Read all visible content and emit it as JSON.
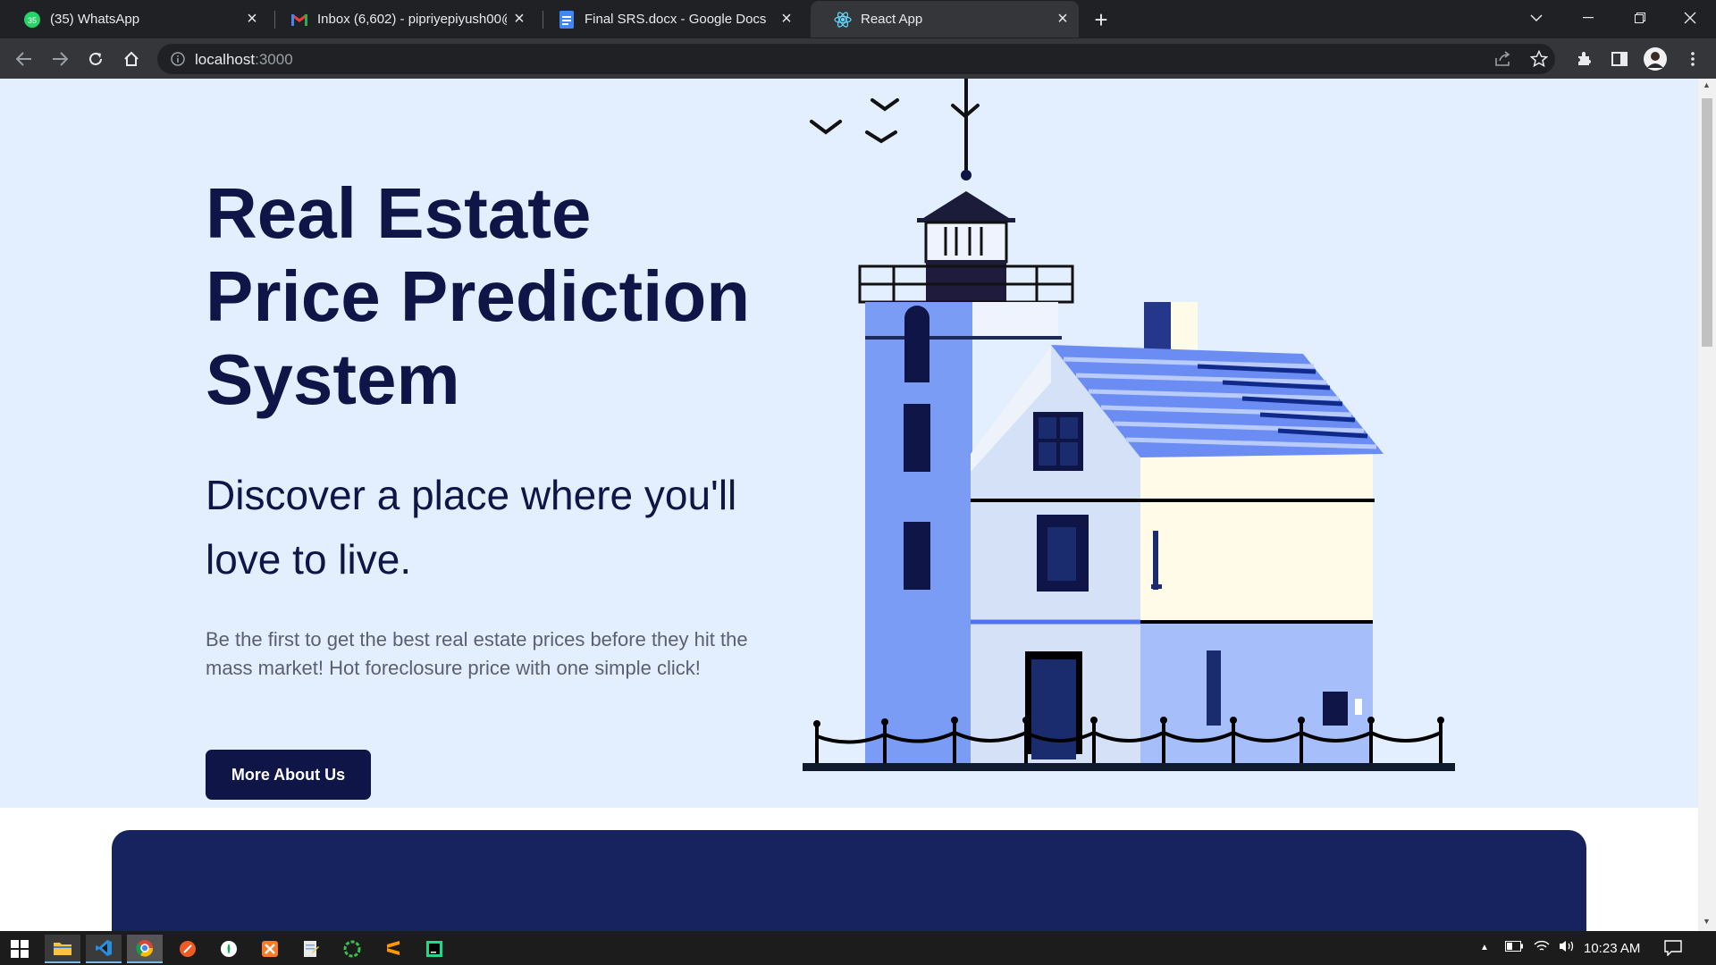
{
  "browser": {
    "tabs": [
      {
        "title": "(35) WhatsApp",
        "icon": "whatsapp-icon",
        "badge": "35"
      },
      {
        "title": "Inbox (6,602) - pipriyepiyush00@",
        "icon": "gmail-icon"
      },
      {
        "title": "Final SRS.docx - Google Docs",
        "icon": "google-docs-icon"
      },
      {
        "title": "React App",
        "icon": "react-icon",
        "active": true
      }
    ],
    "url_host": "localhost",
    "url_port": ":3000"
  },
  "hero": {
    "title": "Real Estate Price Prediction System",
    "subtitle": "Discover a place where you'll love to live.",
    "text": "Be the first to get the best real estate prices before they hit the mass market! Hot foreclosure price with one simple click!",
    "button_label": "More About Us"
  },
  "colors": {
    "hero_bg": "#e3eefe",
    "navy": "#0f1547",
    "panel": "#16235e",
    "accent_blue": "#7a9cf5"
  },
  "taskbar": {
    "time": "10:23 AM",
    "apps": [
      "file-explorer-icon",
      "vscode-icon",
      "chrome-icon",
      "postman-icon",
      "mongodb-compass-icon",
      "xampp-icon",
      "notepad-icon",
      "app-icon-green",
      "sublime-icon",
      "pycharm-icon"
    ]
  }
}
